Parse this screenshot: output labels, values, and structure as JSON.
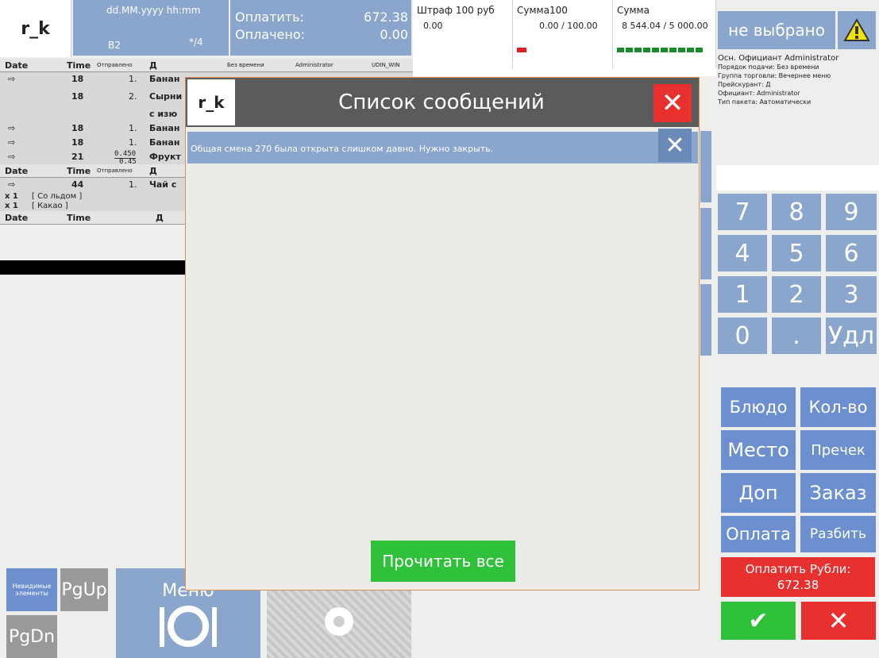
{
  "header": {
    "logo": "r_k",
    "date_format": "dd.MM.yyyy hh:mm",
    "table": "B2",
    "guests": "*/4",
    "pay_label": "Оплатить:",
    "pay_value": "672.38",
    "paid_label": "Оплачено:",
    "paid_value": "0.00"
  },
  "info": [
    {
      "title": "Штраф 100 руб",
      "value": "0.00"
    },
    {
      "title": "Сумма100",
      "value": "0.00 / 100.00"
    },
    {
      "title": "Сумма",
      "value": "8 544.04 / 5 000.00"
    }
  ],
  "status": {
    "label": "не выбрано",
    "warn_icon": "warning-icon"
  },
  "right_info": {
    "waiter": "Осн. Официант  Administrator",
    "lines": [
      "Порядок подачи: Без времени",
      "Группа торговли: Вечернее меню",
      "Прейскурант: Д",
      "Официант: Administrator",
      "Тип пакета: Автоматически"
    ]
  },
  "list": {
    "headers": {
      "date": "Date",
      "time": "Time",
      "sent": "Отправлено",
      "d": "Д",
      "no_time": "Без времени",
      "admin": "Administrator",
      "station": "UDIN_WIN"
    },
    "rows": [
      {
        "time": "18",
        "num": "1.",
        "name": "Банан"
      },
      {
        "time": "18",
        "num": "2.",
        "name": "Сырни"
      },
      {
        "time": "",
        "num": "",
        "name": "с изю"
      },
      {
        "time": "18",
        "num": "1.",
        "name": "Банан"
      },
      {
        "time": "18",
        "num": "1.",
        "name": "Банан"
      },
      {
        "time": "21",
        "num": "0.450",
        "name": "Фрукт"
      }
    ],
    "fraction_bottom": "0.45",
    "row2": {
      "time": "44",
      "num": "1.",
      "name": "Чай с"
    },
    "mods": [
      {
        "qty": "x 1",
        "name": "[ Со льдом ]"
      },
      {
        "qty": "x 1",
        "name": "[ Какао ]"
      }
    ]
  },
  "keypad": [
    "7",
    "8",
    "9",
    "4",
    "5",
    "6",
    "1",
    "2",
    "3",
    "0",
    ".",
    "Удл"
  ],
  "actions": [
    "Блюдо",
    "Кол-во",
    "Место",
    "Пречек",
    "Доп",
    "Заказ",
    "Оплата",
    "Разбить"
  ],
  "pay_button": {
    "label": "Оплатить Рубли:",
    "value": "672.38"
  },
  "bottom_left": {
    "invisible": "Невидимые элементы",
    "pgup": "PgUp",
    "pgdn": "PgDn",
    "menu": "Меню"
  },
  "modal": {
    "logo": "r_k",
    "title": "Список сообщений",
    "message": "Общая смена 270 была открыта слишком давно. Нужно закрыть.",
    "read_all": "Прочитать все"
  }
}
